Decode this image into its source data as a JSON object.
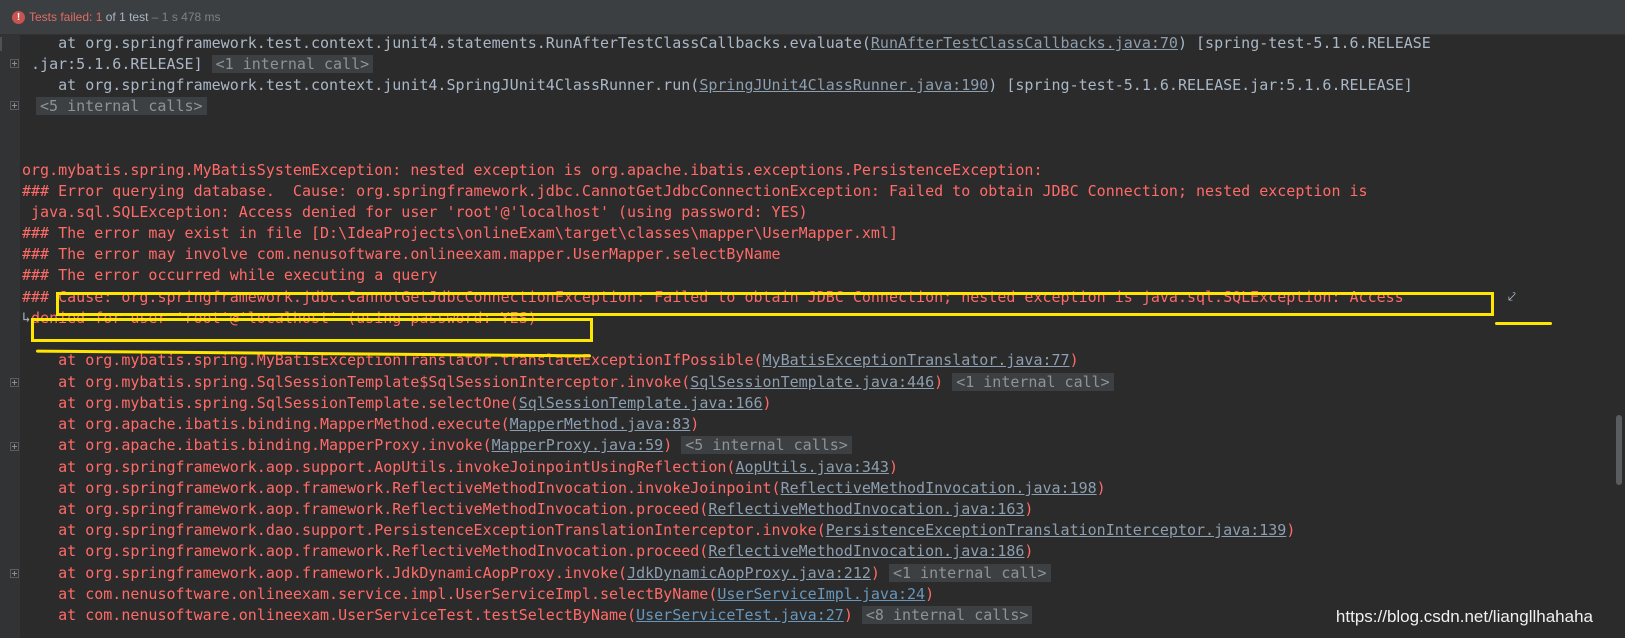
{
  "status_bar": {
    "label": "Tests failed:",
    "failed": "1",
    "of_total": "of 1 test",
    "duration": "– 1 s 478 ms"
  },
  "console": {
    "l1a": "    at org.springframework.test.context.junit4.statements.RunAfterTestClassCallbacks.evaluate(",
    "l1link": "RunAfterTestClassCallbacks.java:70",
    "l1b": ") [spring-test-5.1.6.RELEASE",
    "l2a": " .jar:5.1.6.RELEASE] ",
    "l2badge": "<1 internal call>",
    "l3a": "    at org.springframework.test.context.junit4.SpringJUnit4ClassRunner.run(",
    "l3link": "SpringJUnit4ClassRunner.java:190",
    "l3b": ") [spring-test-5.1.6.RELEASE.jar:5.1.6.RELEASE]",
    "l4badge": "<5 internal calls>",
    "e1": "org.mybatis.spring.MyBatisSystemException: nested exception is org.apache.ibatis.exceptions.PersistenceException: ",
    "e2": "### Error querying database.  Cause: org.springframework.jdbc.CannotGetJdbcConnectionException: Failed to obtain JDBC Connection; nested exception is",
    "e3": " java.sql.SQLException: Access denied for user 'root'@'localhost' (using password: YES)",
    "e4": "### The error may exist in file [D:\\IdeaProjects\\onlineExam\\target\\classes\\mapper\\UserMapper.xml]",
    "e5": "### The error may involve com.nenusoftware.onlineexam.mapper.UserMapper.selectByName",
    "e6": "### The error occurred while executing a query",
    "e7": "### Cause: org.springframework.jdbc.CannotGetJdbcConnectionException: Failed to obtain JDBC Connection; nested exception is java.sql.SQLException: Access",
    "e8": " denied for user 'root'@'localhost' (using password: YES)",
    "s1a": "    at org.mybatis.spring.MyBatisExceptionTranslator.translateExceptionIfPossible(",
    "s1l": "MyBatisExceptionTranslator.java:77",
    "s2a": "    at org.mybatis.spring.SqlSessionTemplate$SqlSessionInterceptor.invoke(",
    "s2l": "SqlSessionTemplate.java:446",
    "s2badge": "<1 internal call>",
    "s3a": "    at org.mybatis.spring.SqlSessionTemplate.selectOne(",
    "s3l": "SqlSessionTemplate.java:166",
    "s4a": "    at org.apache.ibatis.binding.MapperMethod.execute(",
    "s4l": "MapperMethod.java:83",
    "s5a": "    at org.apache.ibatis.binding.MapperProxy.invoke(",
    "s5l": "MapperProxy.java:59",
    "s5badge": "<5 internal calls>",
    "s6a": "    at org.springframework.aop.support.AopUtils.invokeJoinpointUsingReflection(",
    "s6l": "AopUtils.java:343",
    "s7a": "    at org.springframework.aop.framework.ReflectiveMethodInvocation.invokeJoinpoint(",
    "s7l": "ReflectiveMethodInvocation.java:198",
    "s8a": "    at org.springframework.aop.framework.ReflectiveMethodInvocation.proceed(",
    "s8l": "ReflectiveMethodInvocation.java:163",
    "s9a": "    at org.springframework.dao.support.PersistenceExceptionTranslationInterceptor.invoke(",
    "s9l": "PersistenceExceptionTranslationInterceptor.java:139",
    "s10a": "    at org.springframework.aop.framework.ReflectiveMethodInvocation.proceed(",
    "s10l": "ReflectiveMethodInvocation.java:186",
    "s11a": "    at org.springframework.aop.framework.JdkDynamicAopProxy.invoke(",
    "s11l": "JdkDynamicAopProxy.java:212",
    "s11badge": "<1 internal call>",
    "s12a": "    at com.nenusoftware.onlineexam.service.impl.UserServiceImpl.selectByName(",
    "s12l": "UserServiceImpl.java:24",
    "s13a": "    at com.nenusoftware.onlineexam.UserServiceTest.testSelectByName(",
    "s13l": "UserServiceTest.java:27",
    "s13badge": "<8 internal calls>"
  },
  "watermark": "https://blog.csdn.net/liangllhahaha",
  "colors": {
    "background": "#2b2b2b",
    "error_text": "#ff6b68",
    "link": "#6897bb",
    "highlight": "#ffe600"
  }
}
